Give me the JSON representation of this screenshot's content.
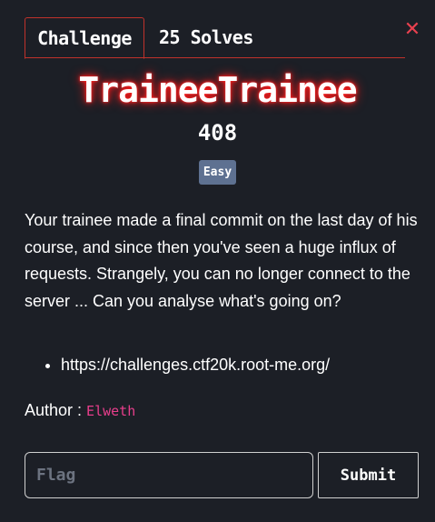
{
  "tabs": [
    {
      "label": "Challenge",
      "active": true
    },
    {
      "label": "25 Solves",
      "active": false
    }
  ],
  "close_icon": "close-icon",
  "challenge": {
    "title": "TraineeTrainee",
    "points": "408",
    "difficulty": "Easy",
    "description": "Your trainee made a final commit on the last day of his course, and since then you've seen a huge influx of requests. Strangely, you can no longer connect to the server ... Can you analyse what's going on?",
    "links": [
      "https://challenges.ctf20k.root-me.org/"
    ],
    "author_label": "Author : ",
    "author_name": "Elweth"
  },
  "form": {
    "flag_placeholder": "Flag",
    "flag_value": "",
    "submit_label": "Submit"
  },
  "colors": {
    "background": "#1c1f26",
    "accent_red": "#c0322b",
    "close_red": "#e8414f",
    "title_glow": "#ff1a1a",
    "badge": "#5e7191",
    "author": "#e83e8c"
  }
}
